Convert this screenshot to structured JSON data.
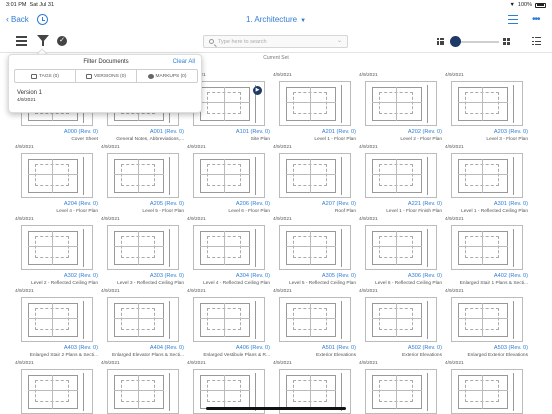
{
  "status": {
    "time": "3:01 PM",
    "date": "Sat Jul 31",
    "battery": "100%"
  },
  "nav": {
    "back_label": "Back",
    "title": "1. Architecture"
  },
  "toolbar": {
    "search_placeholder": "Type here to search"
  },
  "current_set_label": "Current Set",
  "filter": {
    "title": "Filter Documents",
    "clear_label": "Clear All",
    "tabs": [
      {
        "label": "TAGS (0)",
        "icon": "tag-icon"
      },
      {
        "label": "VERSIONS (0)",
        "icon": "versions-icon"
      },
      {
        "label": "MARKUPS (0)",
        "icon": "markups-icon"
      }
    ],
    "version_title": "Version 1",
    "version_date": "4/9/2021"
  },
  "accent_color": "#2f7dd4",
  "sheets": [
    {
      "date": "4/9/2021",
      "code": "A000 (Rev. 0)",
      "name": "Cover Sheet"
    },
    {
      "date": "4/9/2021",
      "code": "A001 (Rev. 0)",
      "name": "General Notes, Abbreviations,..."
    },
    {
      "date": "4/9/2021",
      "code": "A101 (Rev. 0)",
      "name": "Site Plan"
    },
    {
      "date": "4/9/2021",
      "code": "A201 (Rev. 0)",
      "name": "Level 1 - Floor Plan"
    },
    {
      "date": "4/9/2021",
      "code": "A202 (Rev. 0)",
      "name": "Level 2 - Floor Plan"
    },
    {
      "date": "4/9/2021",
      "code": "A203 (Rev. 0)",
      "name": "Level 3 - Floor Plan"
    },
    {
      "date": "4/9/2021",
      "code": "A204 (Rev. 0)",
      "name": "Level 4 - Floor Plan"
    },
    {
      "date": "4/9/2021",
      "code": "A205 (Rev. 0)",
      "name": "Level 5 - Floor Plan"
    },
    {
      "date": "4/9/2021",
      "code": "A206 (Rev. 0)",
      "name": "Level 6 - Floor Plan"
    },
    {
      "date": "4/9/2021",
      "code": "A207 (Rev. 0)",
      "name": "Roof Plan"
    },
    {
      "date": "4/9/2021",
      "code": "A221 (Rev. 0)",
      "name": "Level 1 - Floor Finish Plan"
    },
    {
      "date": "4/9/2021",
      "code": "A301 (Rev. 0)",
      "name": "Level 1 - Reflected Ceiling Plan"
    },
    {
      "date": "4/9/2021",
      "code": "A302 (Rev. 0)",
      "name": "Level 2 - Reflected Ceiling Plan"
    },
    {
      "date": "4/9/2021",
      "code": "A303 (Rev. 0)",
      "name": "Level 3 - Reflected Ceiling Plan"
    },
    {
      "date": "4/9/2021",
      "code": "A304 (Rev. 0)",
      "name": "Level 4 - Reflected Ceiling Plan"
    },
    {
      "date": "4/9/2021",
      "code": "A305 (Rev. 0)",
      "name": "Level 5 - Reflected Ceiling Plan"
    },
    {
      "date": "4/9/2021",
      "code": "A306 (Rev. 0)",
      "name": "Level 6 - Reflected Ceiling Plan"
    },
    {
      "date": "4/9/2021",
      "code": "A402 (Rev. 0)",
      "name": "Enlarged Stair 1 Plans & Secti..."
    },
    {
      "date": "4/9/2021",
      "code": "A403 (Rev. 0)",
      "name": "Enlarged Stair 2 Plans & Secti..."
    },
    {
      "date": "4/9/2021",
      "code": "A404 (Rev. 0)",
      "name": "Enlarged Elevator Plans & Secti..."
    },
    {
      "date": "4/9/2021",
      "code": "A406 (Rev. 0)",
      "name": "Enlarged Vestibule Plans & R..."
    },
    {
      "date": "4/9/2021",
      "code": "A501 (Rev. 0)",
      "name": "Exterior Elevations"
    },
    {
      "date": "4/9/2021",
      "code": "A502 (Rev. 0)",
      "name": "Exterior Elevations"
    },
    {
      "date": "4/9/2021",
      "code": "A503 (Rev. 0)",
      "name": "Enlarged Exterior Elevations"
    },
    {
      "date": "4/9/2021",
      "code": "",
      "name": ""
    },
    {
      "date": "4/9/2021",
      "code": "",
      "name": ""
    },
    {
      "date": "4/9/2021",
      "code": "",
      "name": ""
    },
    {
      "date": "4/9/2021",
      "code": "",
      "name": ""
    },
    {
      "date": "4/9/2021",
      "code": "",
      "name": ""
    },
    {
      "date": "4/9/2021",
      "code": "",
      "name": ""
    }
  ]
}
